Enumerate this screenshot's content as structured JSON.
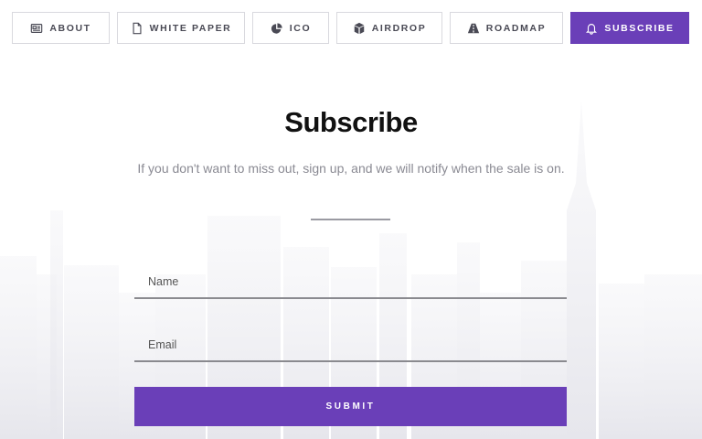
{
  "nav": {
    "items": [
      {
        "label": "ABOUT",
        "icon": "newspaper-icon"
      },
      {
        "label": "WHITE PAPER",
        "icon": "document-icon"
      },
      {
        "label": "ICO",
        "icon": "pie-chart-icon"
      },
      {
        "label": "AIRDROP",
        "icon": "cube-icon"
      },
      {
        "label": "ROADMAP",
        "icon": "road-icon"
      },
      {
        "label": "SUBSCRIBE",
        "icon": "bell-icon",
        "active": true
      }
    ]
  },
  "subscribe": {
    "title": "Subscribe",
    "subtitle": "If you don't want to miss out, sign up, and we will notify when the sale is on.",
    "name_placeholder": "Name",
    "email_placeholder": "Email",
    "submit_label": "SUBMIT"
  },
  "colors": {
    "accent": "#6a3fb8",
    "nav_border": "#d9d9de",
    "skyline": "#ececf0"
  }
}
